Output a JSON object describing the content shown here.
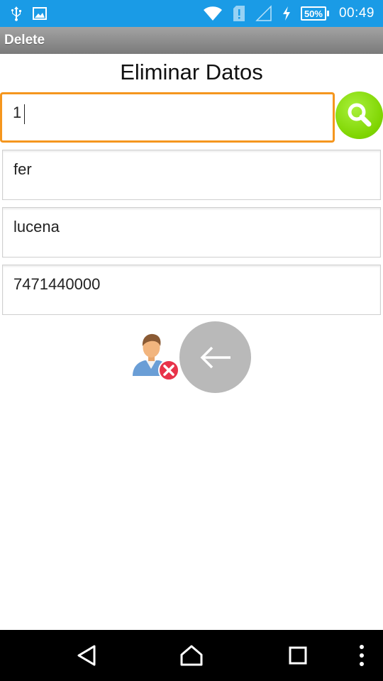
{
  "status_bar": {
    "battery_percent": "50%",
    "time": "00:49",
    "icons": [
      "usb-icon",
      "image-icon",
      "wifi-icon",
      "sim-alert-icon",
      "no-signal-icon",
      "charging-icon",
      "battery-icon"
    ]
  },
  "action_bar": {
    "title": "Delete"
  },
  "page": {
    "title": "Eliminar Datos"
  },
  "form": {
    "search_value": "1",
    "name_value": "fer",
    "surname_value": "lucena",
    "phone_value": "7471440000"
  },
  "colors": {
    "status_bar": "#1a9be6",
    "focus_border": "#f5961e",
    "search_button": "#7ed400",
    "back_button": "#b9b9b9"
  },
  "nav_bar": {
    "icons": [
      "back-nav-icon",
      "home-nav-icon",
      "recents-nav-icon",
      "overflow-menu-icon"
    ]
  }
}
